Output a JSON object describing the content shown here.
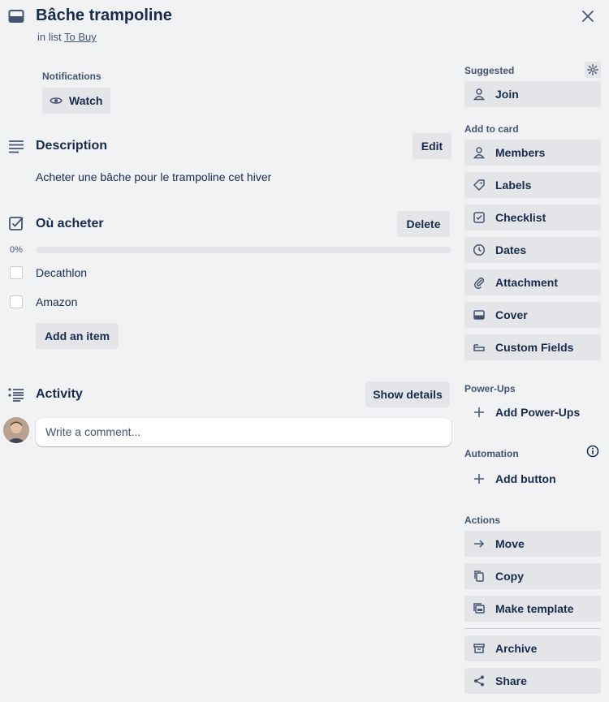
{
  "card": {
    "title": "Bâche trampoline",
    "in_list_prefix": "in list",
    "list_name": "To Buy"
  },
  "notifications": {
    "label": "Notifications",
    "watch_label": "Watch"
  },
  "description": {
    "title": "Description",
    "edit_label": "Edit",
    "text": "Acheter une bâche pour le trampoline cet hiver"
  },
  "checklist": {
    "title": "Où acheter",
    "delete_label": "Delete",
    "progress_text": "0%",
    "progress_fraction": 0,
    "items": [
      {
        "label": "Decathlon",
        "checked": false
      },
      {
        "label": "Amazon",
        "checked": false
      }
    ],
    "add_item_label": "Add an item"
  },
  "activity": {
    "title": "Activity",
    "show_details_label": "Show details",
    "comment_placeholder": "Write a comment..."
  },
  "sidebar": {
    "suggested_label": "Suggested",
    "join_label": "Join",
    "add_to_card_label": "Add to card",
    "add_to_card": [
      {
        "label": "Members",
        "icon": "person-icon"
      },
      {
        "label": "Labels",
        "icon": "tag-icon"
      },
      {
        "label": "Checklist",
        "icon": "checklist-icon"
      },
      {
        "label": "Dates",
        "icon": "clock-icon"
      },
      {
        "label": "Attachment",
        "icon": "paperclip-icon"
      },
      {
        "label": "Cover",
        "icon": "cover-icon"
      },
      {
        "label": "Custom Fields",
        "icon": "custom-fields-icon"
      }
    ],
    "powerups_label": "Power-Ups",
    "add_powerups_label": "Add Power-Ups",
    "automation_label": "Automation",
    "add_button_label": "Add button",
    "actions_label": "Actions",
    "actions": [
      {
        "label": "Move",
        "icon": "arrow-right-icon"
      },
      {
        "label": "Copy",
        "icon": "copy-icon"
      },
      {
        "label": "Make template",
        "icon": "template-icon"
      }
    ],
    "archive_label": "Archive",
    "share_label": "Share"
  },
  "colors": {
    "background": "#f1f2f4",
    "button": "#e3e5e8",
    "text": "#172b4d",
    "subtle_text": "#44546f"
  }
}
